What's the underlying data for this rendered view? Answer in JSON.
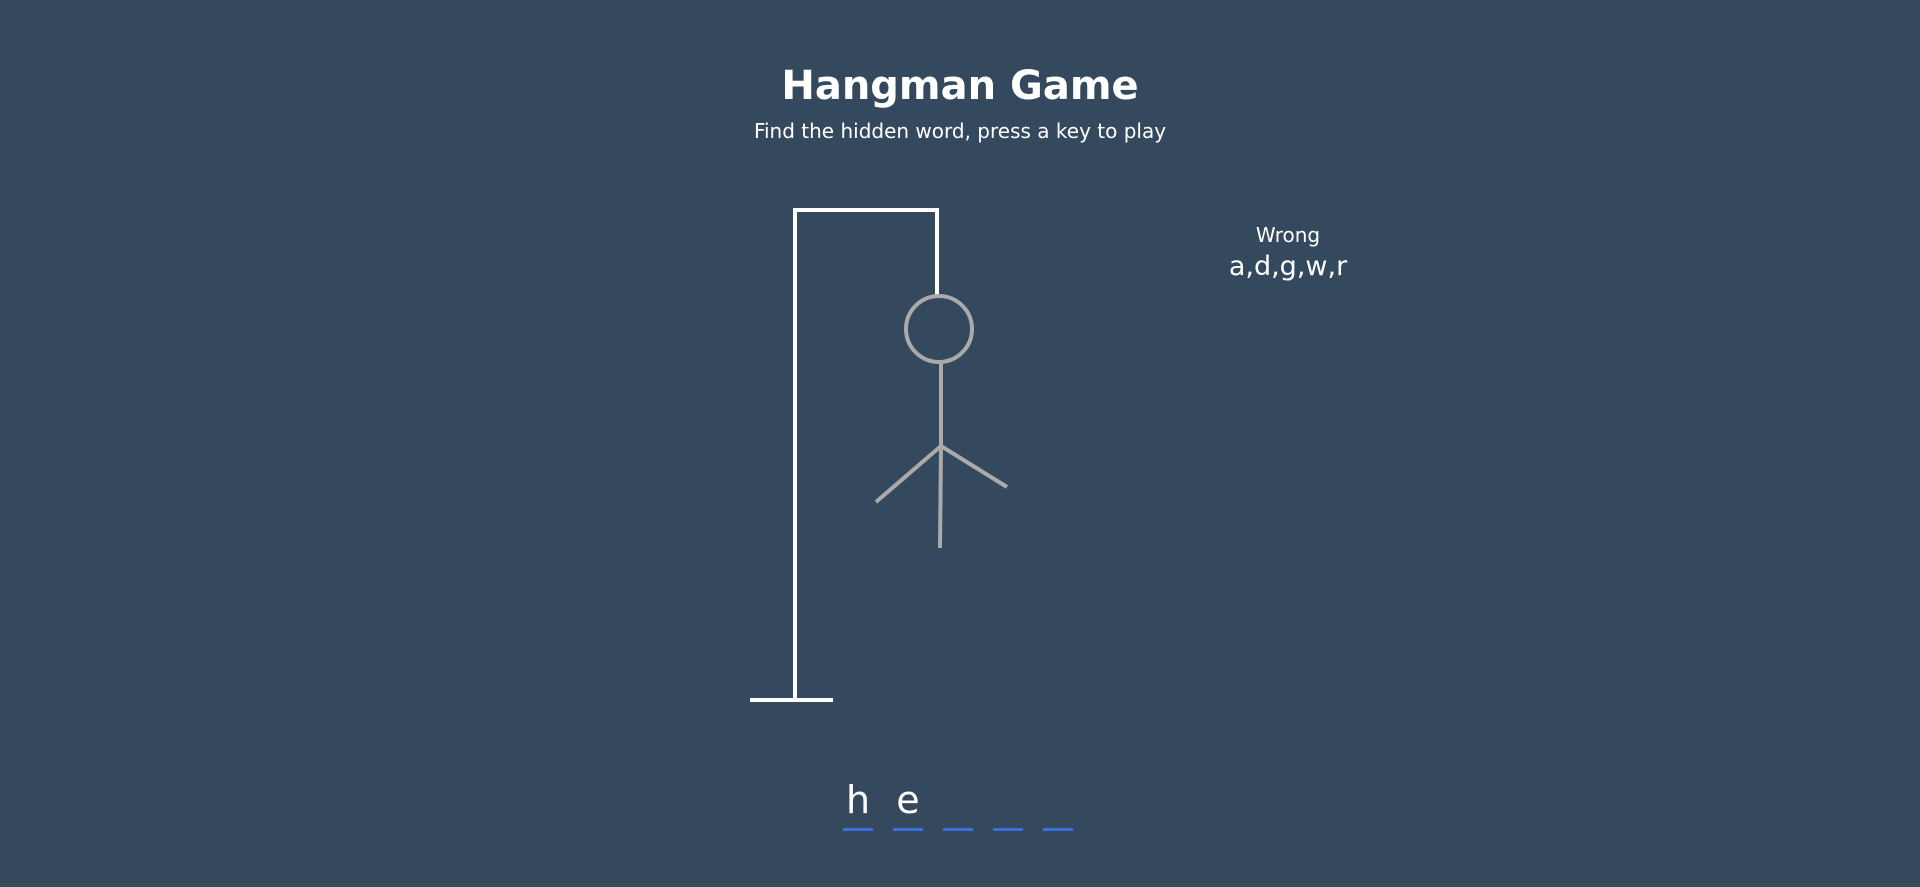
{
  "header": {
    "title": "Hangman Game",
    "subtitle": "Find the hidden word, press a key to play"
  },
  "wrong": {
    "label": "Wrong",
    "letters": "a,d,g,w,r"
  },
  "word": {
    "letters": [
      "h",
      "e",
      "",
      "",
      ""
    ]
  },
  "colors": {
    "background": "#34495e",
    "gallows": "#ffffff",
    "figure": "#aaaaaa",
    "underline": "#3b6fe0"
  },
  "figure_parts_visible": [
    "head",
    "body",
    "left-arm",
    "right-arm",
    "left-leg"
  ]
}
